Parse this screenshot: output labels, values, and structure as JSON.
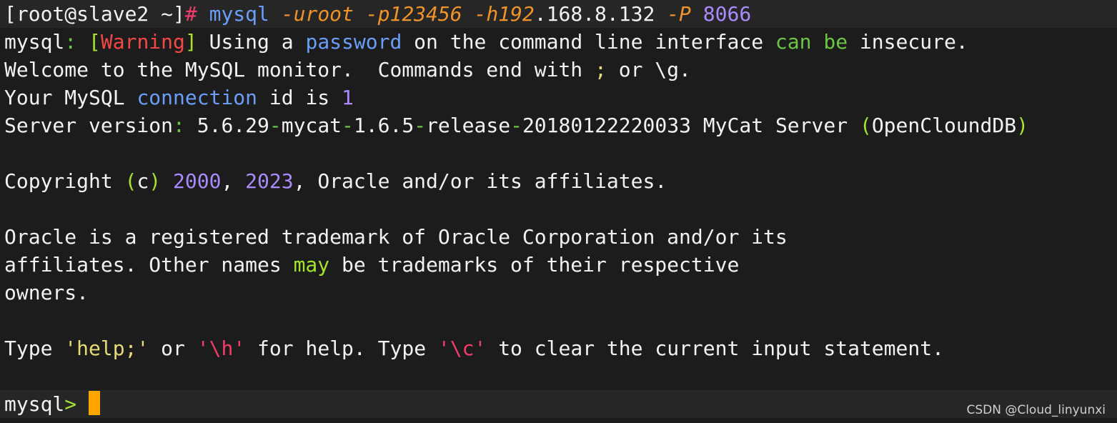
{
  "terminal": {
    "colors": {
      "background": "#1c1c1c",
      "highlight_row": "#262626",
      "default": "#f2f2f2",
      "green": "#6cc644",
      "lime": "#a6e22e",
      "red": "#f24848",
      "blue": "#6a9ef8",
      "orange": "#f0932b",
      "yellow": "#e6db74",
      "purple": "#a98bff",
      "pink": "#f43b6c",
      "cursor": "#ffa500"
    },
    "lines": [
      [
        {
          "t": "[root@slave2 ~]",
          "c": "default"
        },
        {
          "t": "#",
          "c": "pink"
        },
        {
          "t": " mysql",
          "c": "blue"
        },
        {
          "t": " -uroot -p123456 -h192",
          "c": "orange",
          "i": true
        },
        {
          "t": ".168.8.132 ",
          "c": "default"
        },
        {
          "t": "-P",
          "c": "orange",
          "i": true
        },
        {
          "t": " 8066",
          "c": "purple"
        }
      ],
      [
        {
          "t": "mysql",
          "c": "default"
        },
        {
          "t": ": ",
          "c": "green"
        },
        {
          "t": "[",
          "c": "lime"
        },
        {
          "t": "Warning",
          "c": "red"
        },
        {
          "t": "]",
          "c": "lime"
        },
        {
          "t": " Using a ",
          "c": "default"
        },
        {
          "t": "password",
          "c": "blue"
        },
        {
          "t": " on the command line interface ",
          "c": "default"
        },
        {
          "t": "can be",
          "c": "green"
        },
        {
          "t": " insecure.",
          "c": "default"
        }
      ],
      [
        {
          "t": "Welcome to the MySQL monitor.  Commands end with ",
          "c": "default"
        },
        {
          "t": ";",
          "c": "yellow"
        },
        {
          "t": " or \\g.",
          "c": "default"
        }
      ],
      [
        {
          "t": "Your MySQL ",
          "c": "default"
        },
        {
          "t": "connection",
          "c": "blue"
        },
        {
          "t": " id is ",
          "c": "default"
        },
        {
          "t": "1",
          "c": "purple"
        }
      ],
      [
        {
          "t": "Server version",
          "c": "default"
        },
        {
          "t": ": ",
          "c": "green"
        },
        {
          "t": "5.6.29",
          "c": "default"
        },
        {
          "t": "-",
          "c": "green"
        },
        {
          "t": "mycat",
          "c": "default"
        },
        {
          "t": "-",
          "c": "green"
        },
        {
          "t": "1.6.5",
          "c": "default"
        },
        {
          "t": "-",
          "c": "green"
        },
        {
          "t": "release",
          "c": "default"
        },
        {
          "t": "-",
          "c": "green"
        },
        {
          "t": "20180122220033 MyCat Server ",
          "c": "default"
        },
        {
          "t": "(",
          "c": "lime"
        },
        {
          "t": "OpenCloundDB",
          "c": "default"
        },
        {
          "t": ")",
          "c": "lime"
        }
      ],
      [],
      [
        {
          "t": "Copyright ",
          "c": "default"
        },
        {
          "t": "(",
          "c": "lime"
        },
        {
          "t": "c",
          "c": "default"
        },
        {
          "t": ")",
          "c": "lime"
        },
        {
          "t": " ",
          "c": "default"
        },
        {
          "t": "2000",
          "c": "purple"
        },
        {
          "t": ", ",
          "c": "default"
        },
        {
          "t": "2023",
          "c": "purple"
        },
        {
          "t": ", Oracle and/or its affiliates.",
          "c": "default"
        }
      ],
      [],
      [
        {
          "t": "Oracle is a registered trademark of Oracle Corporation and/or its",
          "c": "default"
        }
      ],
      [
        {
          "t": "affiliates. Other names ",
          "c": "default"
        },
        {
          "t": "may",
          "c": "lime"
        },
        {
          "t": " be trademarks of their respective",
          "c": "default"
        }
      ],
      [
        {
          "t": "owners.",
          "c": "default"
        }
      ],
      [],
      [
        {
          "t": "Type ",
          "c": "default"
        },
        {
          "t": "'help;'",
          "c": "yellow"
        },
        {
          "t": " or ",
          "c": "default"
        },
        {
          "t": "'\\h'",
          "c": "pink"
        },
        {
          "t": " for help. Type ",
          "c": "default"
        },
        {
          "t": "'\\c'",
          "c": "pink"
        },
        {
          "t": " to clear the current input statement.",
          "c": "default"
        }
      ],
      [],
      [
        {
          "t": "mysql",
          "c": "default"
        },
        {
          "t": ">",
          "c": "lime"
        },
        {
          "t": " ",
          "c": "default"
        }
      ]
    ],
    "highlight_rows": [
      0,
      14
    ],
    "cursor_row": 14
  },
  "watermark": "CSDN @Cloud_linyunxi"
}
